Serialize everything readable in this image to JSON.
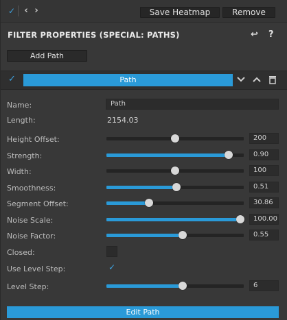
{
  "toolbar": {
    "check_glyph": "✓",
    "back_glyph": "‹",
    "forward_glyph": "›",
    "save_heatmap_label": "Save Heatmap",
    "remove_label": "Remove"
  },
  "header": {
    "title": "FILTER PROPERTIES (SPECIAL: PATHS)",
    "back_icon_glyph": "↩",
    "help_icon_glyph": "?"
  },
  "add_path_label": "Add Path",
  "path": {
    "enabled_glyph": "✓",
    "name_bar_label": "Path",
    "icons": [
      "chevron-down-icon",
      "chevron-up-icon",
      "trash-icon"
    ]
  },
  "properties": {
    "name": {
      "label": "Name:",
      "value": "Path"
    },
    "length": {
      "label": "Length:",
      "value": "2154.03"
    },
    "sliders": [
      {
        "id": "height-offset",
        "label": "Height Offset:",
        "value": "200",
        "fraction": 0.5,
        "filled": false
      },
      {
        "id": "strength",
        "label": "Strength:",
        "value": "0.90",
        "fraction": 0.89,
        "filled": true
      },
      {
        "id": "width",
        "label": "Width:",
        "value": "100",
        "fraction": 0.5,
        "filled": false
      },
      {
        "id": "smoothness",
        "label": "Smoothness:",
        "value": "0.51",
        "fraction": 0.51,
        "filled": true
      },
      {
        "id": "segment-offset",
        "label": "Segment Offset:",
        "value": "30.86",
        "fraction": 0.31,
        "filled": true
      },
      {
        "id": "noise-scale",
        "label": "Noise Scale:",
        "value": "100.00",
        "fraction": 0.975,
        "filled": true
      },
      {
        "id": "noise-factor",
        "label": "Noise Factor:",
        "value": "0.55",
        "fraction": 0.555,
        "filled": true
      }
    ],
    "closed": {
      "label": "Closed:",
      "checked": false,
      "glyph": ""
    },
    "use_level_step": {
      "label": "Use Level Step:",
      "checked": true,
      "glyph": "✓"
    },
    "level_step": {
      "label": "Level Step:",
      "value": "6",
      "fraction": 0.555,
      "filled": true
    }
  },
  "edit_path_label": "Edit Path",
  "colors": {
    "accent": "#2a9ad8",
    "background": "#383838",
    "field": "#2c2c2c"
  }
}
